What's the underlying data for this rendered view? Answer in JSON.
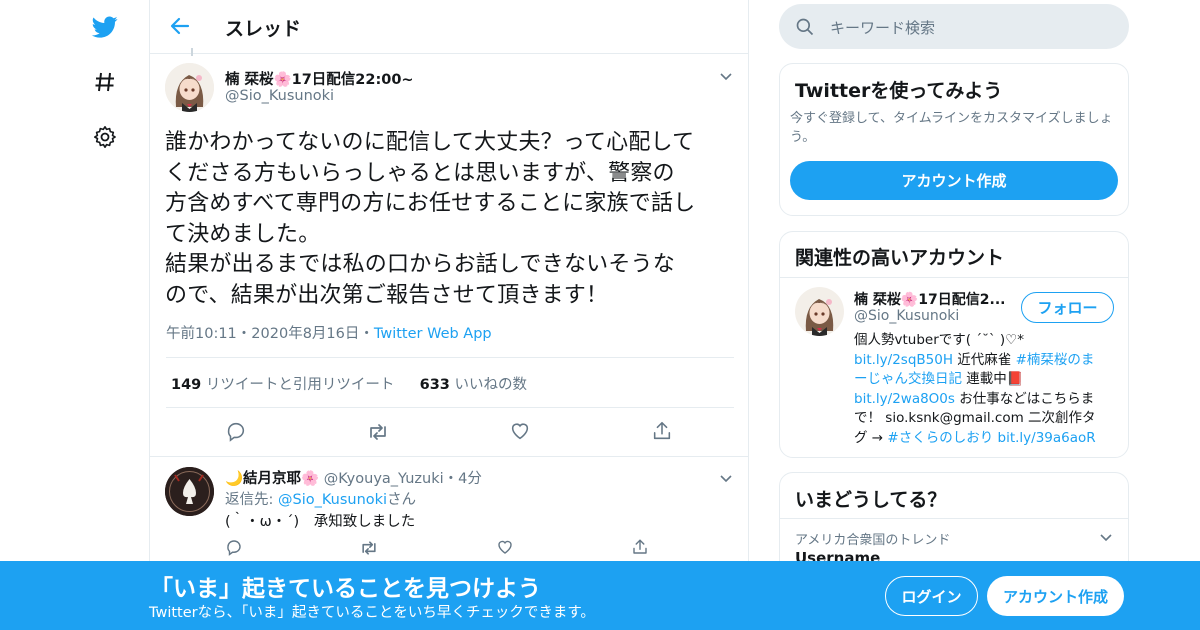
{
  "header": {
    "title": "スレッド"
  },
  "tweet": {
    "author_name": "楠 栞桜🌸17日配信22:00~",
    "author_handle": "@Sio_Kusunoki",
    "text": "誰かわかってないのに配信して大丈夫？って心配して\nくださる方もいらっしゃるとは思いますが、警察の\n方含めすべて専門の方にお任せすることに家族で話し\nて決めました。\n結果が出るまでは私の口からお話しできないそうな\nので、結果が出次第ご報告させて頂きます！",
    "time": "午前10:11・2020年8月16日・",
    "source": "Twitter Web App",
    "retweets_count": "149",
    "retweets_label": "リツイートと引用リツイート",
    "likes_count": "633",
    "likes_label": "いいねの数"
  },
  "reply": {
    "author_name": "🌙結月京耶🌸",
    "author_handle": "@Kyouya_Yuzuki",
    "time": "・4分",
    "reply_to_prefix": "返信先: ",
    "reply_to_handle": "@Sio_Kusunoki",
    "reply_to_suffix": "さん",
    "text": "(｀・ω・´)　承知致しました"
  },
  "search": {
    "placeholder": "キーワード検索"
  },
  "signup_card": {
    "title": "Twitterを使ってみよう",
    "body": "今すぐ登録して、タイムラインをカスタマイズしましょう。",
    "button": "アカウント作成"
  },
  "related": {
    "title": "関連性の高いアカウント",
    "name": "楠 栞桜🌸17日配信2...",
    "handle": "@Sio_Kusunoki",
    "follow": "フォロー",
    "bio": {
      "l1": "個人勢vtuberです( ´˘` )♡*",
      "l2_link": "bit.ly/2sqB50H",
      "l2_text": " 近代麻雀 ",
      "l2_tag": "#楠栞桜のま",
      "l3_tag": "ーじゃん交換日記",
      "l3_text": " 連載中📕",
      "l4_link": "bit.ly/2wa8O0s",
      "l4_text": " お仕事などはこちらま",
      "l5": "で！ sio.ksnk@gmail.com 二次創作タ",
      "l6_text": "グ → ",
      "l6_tag": "#さくらのしおり",
      "l6_link": " bit.ly/39a6aoR"
    }
  },
  "trends": {
    "title": "いまどうしてる？",
    "location": "アメリカ合衆国のトレンド",
    "item": "Username"
  },
  "bottom": {
    "headline": "「いま」起きていることを見つけよう",
    "sub": "Twitterなら、「いま」起きていることをいち早くチェックできます。",
    "login": "ログイン",
    "signup": "アカウント作成"
  },
  "colors": {
    "accent": "#1da1f2",
    "text": "#14171a",
    "secondary": "#657786",
    "border": "#e6ecf0"
  }
}
